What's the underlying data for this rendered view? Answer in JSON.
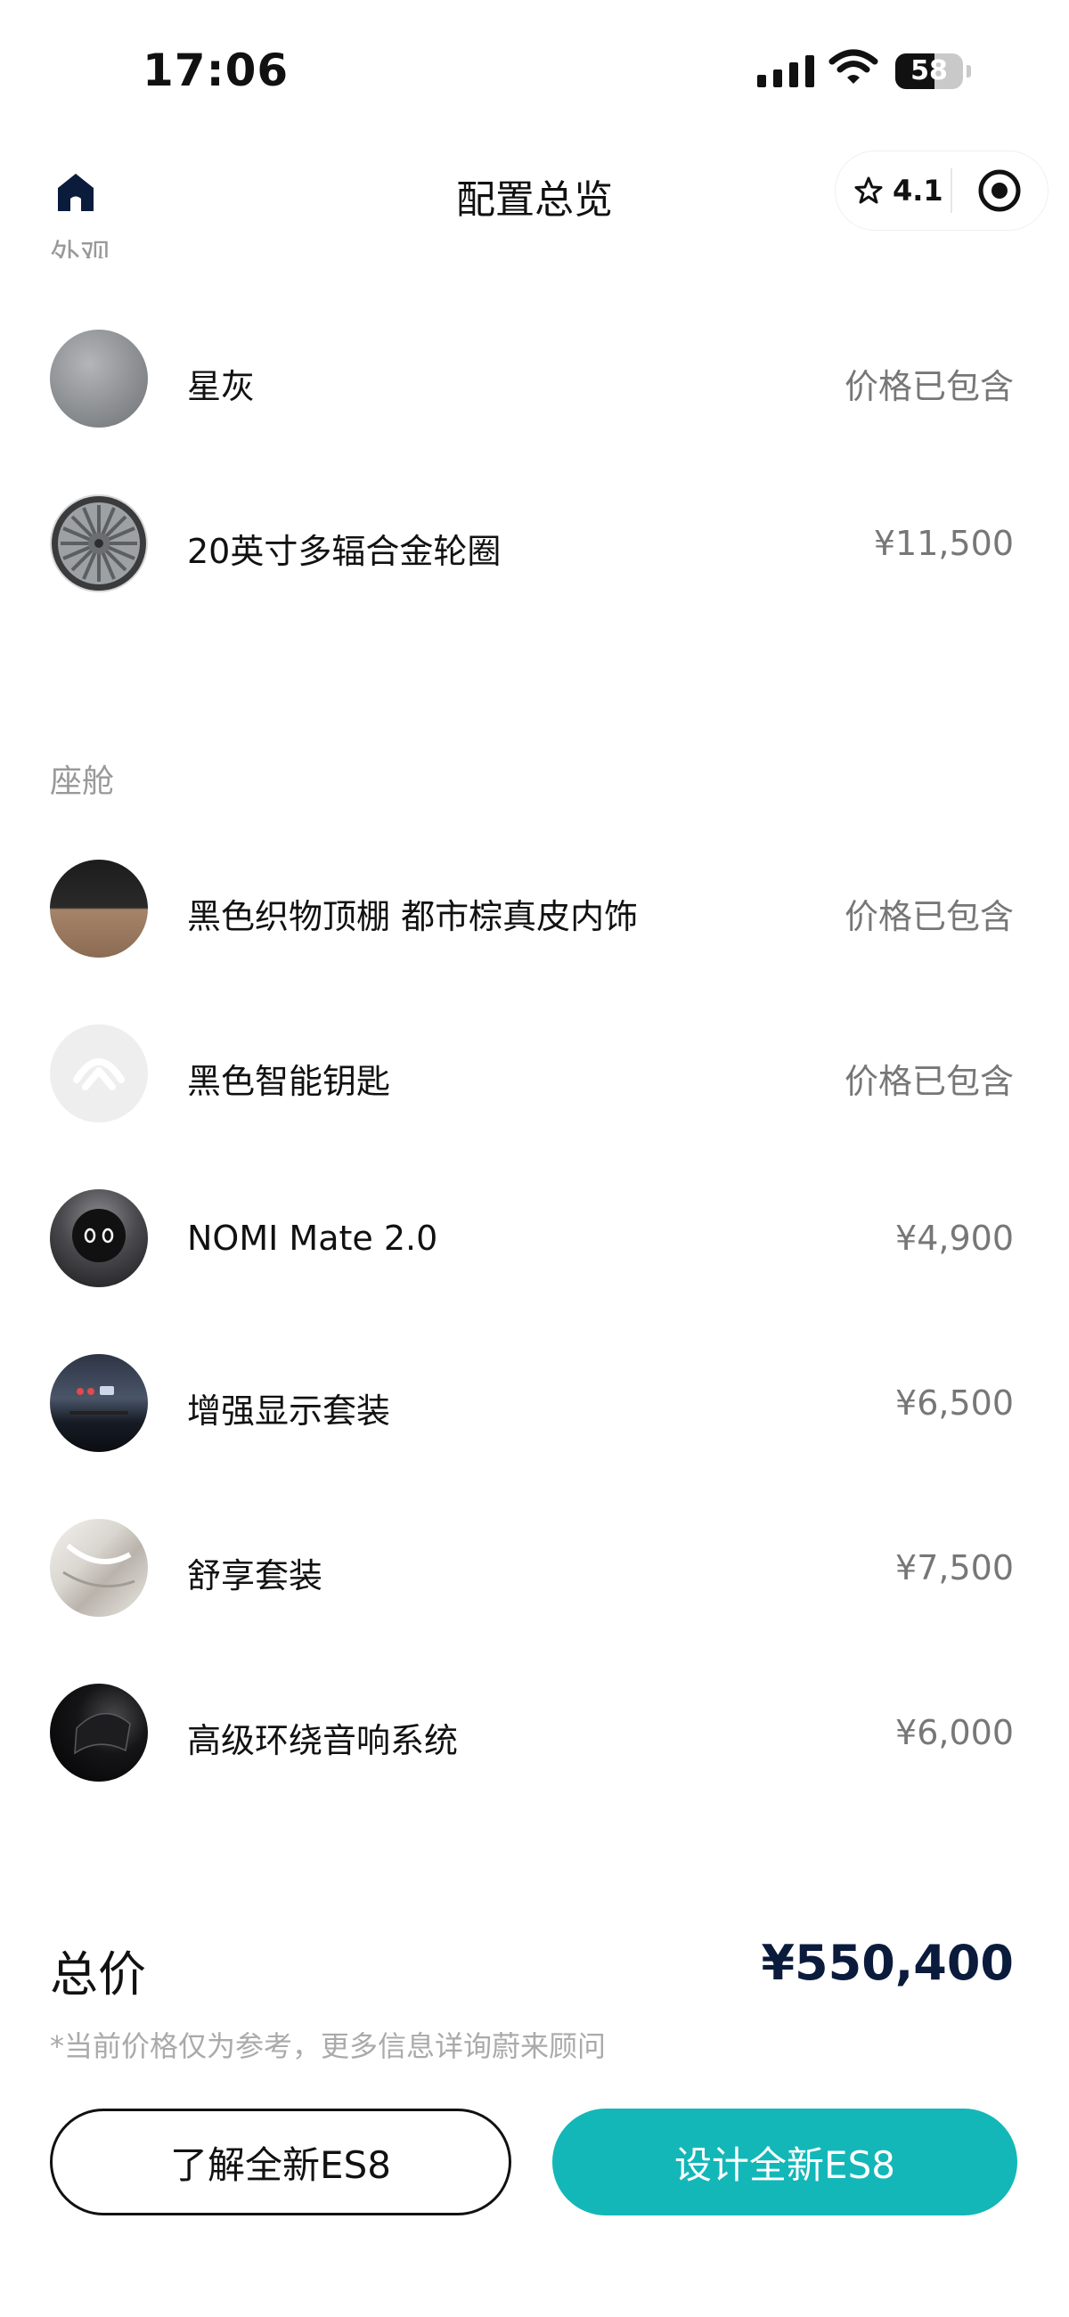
{
  "status_bar": {
    "time": "17:06",
    "battery": "58",
    "battery_level": 0.58
  },
  "nav": {
    "title": "配置总览",
    "rating": "4.1"
  },
  "exterior": {
    "section_label": "外观",
    "items": [
      {
        "name": "星灰",
        "price": "价格已包含"
      },
      {
        "name": "20英寸多辐合金轮圈",
        "price": "¥11,500"
      }
    ]
  },
  "cabin": {
    "section_label": "座舱",
    "items": [
      {
        "name": "黑色织物顶棚 都市棕真皮内饰",
        "price": "价格已包含"
      },
      {
        "name": "黑色智能钥匙",
        "price": "价格已包含"
      },
      {
        "name": "NOMI Mate 2.0",
        "price": "¥4,900"
      },
      {
        "name": "增强显示套装",
        "price": "¥6,500"
      },
      {
        "name": "舒享套装",
        "price": "¥7,500"
      },
      {
        "name": "高级环绕音响系统",
        "price": "¥6,000"
      }
    ]
  },
  "summary": {
    "total_label": "总价",
    "total_value": "¥550,400",
    "disclaimer": "*当前价格仅为参考，更多信息详询蔚来顾问"
  },
  "actions": {
    "learn_label": "了解全新ES8",
    "design_label": "设计全新ES8"
  },
  "colors": {
    "accent": "#13b7b8",
    "price_text": "#777777",
    "total_text": "#0a1b3c"
  }
}
